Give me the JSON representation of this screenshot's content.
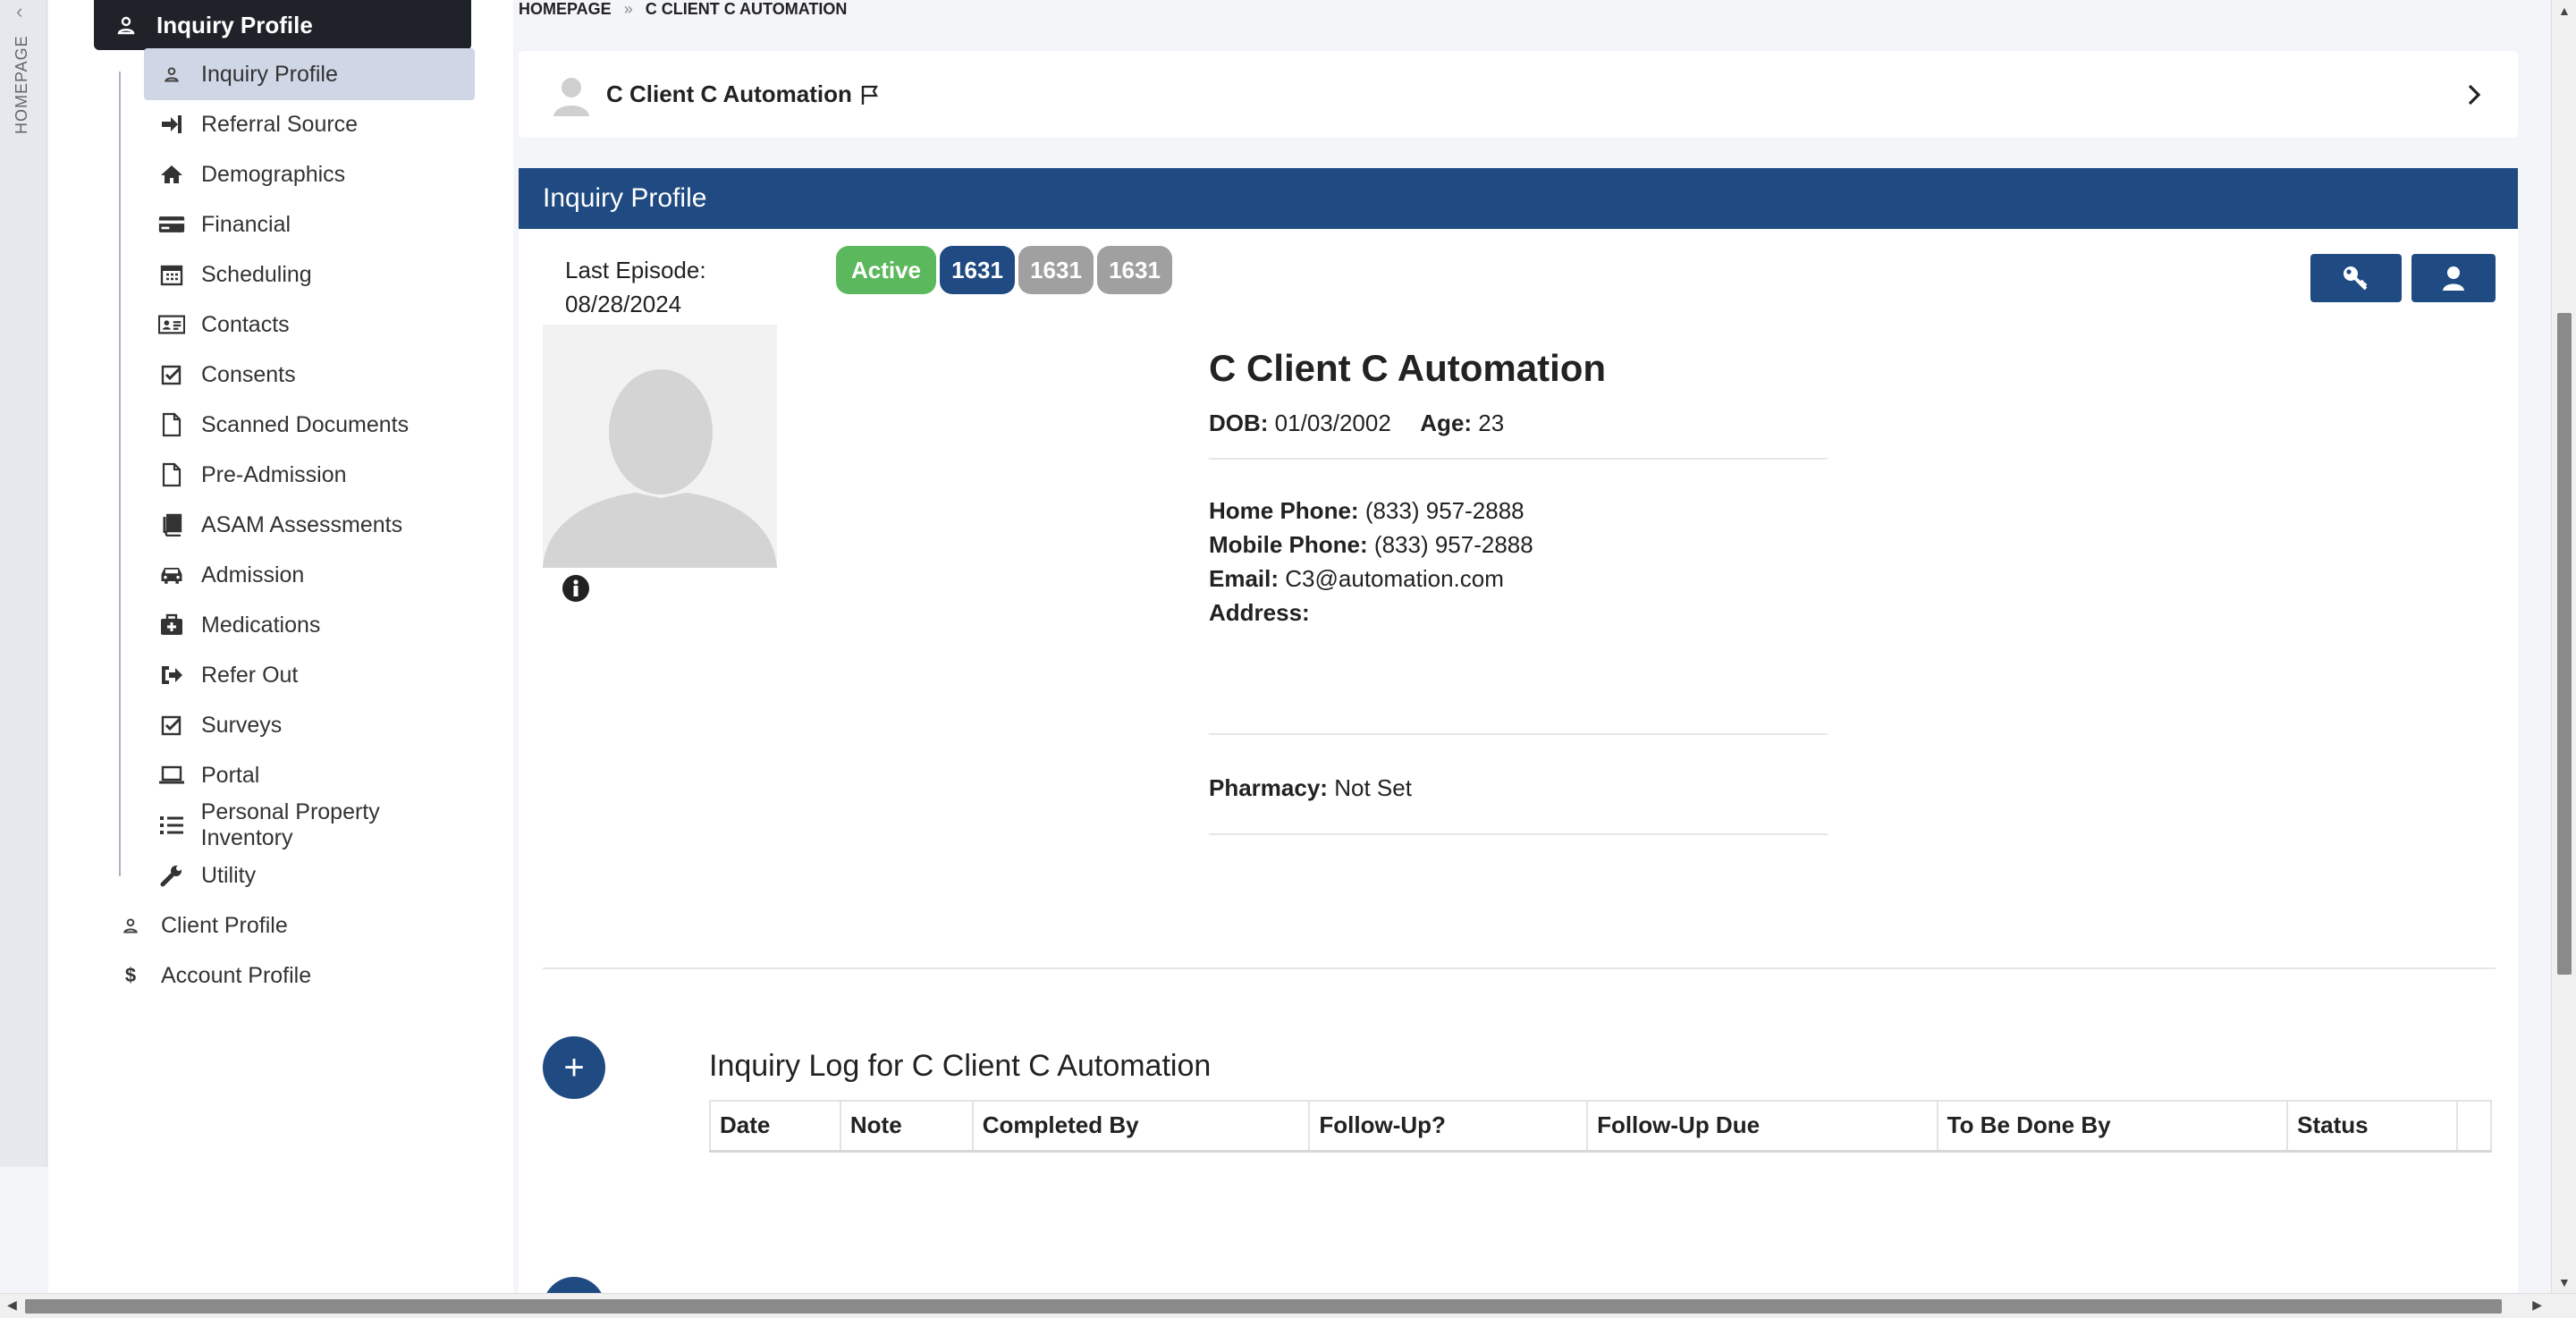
{
  "rail": {
    "label": "HOMEPAGE",
    "collapse_glyph": "‹"
  },
  "sidebar": {
    "active_section": "Inquiry Profile",
    "items": [
      {
        "label": "Inquiry Profile",
        "icon": "user-icon"
      },
      {
        "label": "Referral Source",
        "icon": "sign-in-icon"
      },
      {
        "label": "Demographics",
        "icon": "home-icon"
      },
      {
        "label": "Financial",
        "icon": "credit-card-icon"
      },
      {
        "label": "Scheduling",
        "icon": "calendar-icon"
      },
      {
        "label": "Contacts",
        "icon": "address-card-icon"
      },
      {
        "label": "Consents",
        "icon": "check-square-icon"
      },
      {
        "label": "Scanned Documents",
        "icon": "file-icon"
      },
      {
        "label": "Pre-Admission",
        "icon": "file-icon"
      },
      {
        "label": "ASAM Assessments",
        "icon": "book-icon"
      },
      {
        "label": "Admission",
        "icon": "car-icon"
      },
      {
        "label": "Medications",
        "icon": "medkit-icon"
      },
      {
        "label": "Refer Out",
        "icon": "sign-out-icon"
      },
      {
        "label": "Surveys",
        "icon": "check-square-icon"
      },
      {
        "label": "Portal",
        "icon": "laptop-icon"
      },
      {
        "label": "Personal Property Inventory",
        "icon": "list-icon"
      },
      {
        "label": "Utility",
        "icon": "wrench-icon"
      }
    ],
    "roots": [
      {
        "label": "Client Profile",
        "icon": "user-icon"
      },
      {
        "label": "Account Profile",
        "icon": "dollar-icon"
      }
    ]
  },
  "breadcrumb": {
    "home": "HOMEPAGE",
    "sep": "»",
    "current": "C CLIENT C AUTOMATION"
  },
  "client_bar": {
    "name": "C Client C Automation"
  },
  "card": {
    "title": "Inquiry Profile",
    "last_episode_label": "Last Episode:",
    "last_episode_date": "08/28/2024",
    "badges": [
      "Active",
      "1631",
      "1631",
      "1631"
    ],
    "client_name": "C Client C Automation",
    "dob_label": "DOB:",
    "dob": "01/03/2002",
    "age_label": "Age:",
    "age": "23",
    "home_phone_label": "Home Phone:",
    "home_phone": "(833) 957-2888",
    "mobile_phone_label": "Mobile Phone:",
    "mobile_phone": "(833) 957-2888",
    "email_label": "Email:",
    "email": "C3@automation.com",
    "address_label": "Address:",
    "pharmacy_label": "Pharmacy:",
    "pharmacy": "Not Set"
  },
  "inquiry_log": {
    "title": "Inquiry Log for C Client C Automation",
    "add_glyph": "+",
    "columns": [
      "Date",
      "Note",
      "Completed By",
      "Follow-Up?",
      "Follow-Up Due",
      "To Be Done By",
      "Status",
      ""
    ]
  },
  "colors": {
    "primary": "#1f4a82",
    "active_badge": "#5cb85c",
    "inactive_badge": "#a0a0a0",
    "sidebar_active": "#1f2329"
  }
}
